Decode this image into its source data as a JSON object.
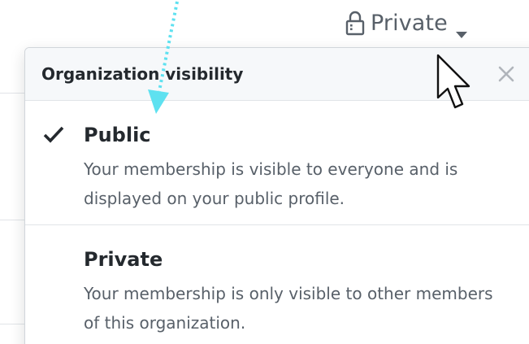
{
  "trigger": {
    "label": "Private",
    "lock_icon": "lock-icon",
    "caret_icon": "caret-down-icon"
  },
  "popover": {
    "title": "Organization visibility",
    "close_icon": "close-icon",
    "items": [
      {
        "title": "Public",
        "description": "Your membership is visible to everyone and is displayed on your public profile.",
        "selected": true
      },
      {
        "title": "Private",
        "description": "Your membership is only visible to other members of this organization.",
        "selected": false
      }
    ]
  },
  "colors": {
    "text_primary": "#24292e",
    "text_secondary": "#586069",
    "header_bg": "#f6f8fa",
    "border": "#e1e4e8",
    "annotation_arrow": "#5ee1f0"
  }
}
